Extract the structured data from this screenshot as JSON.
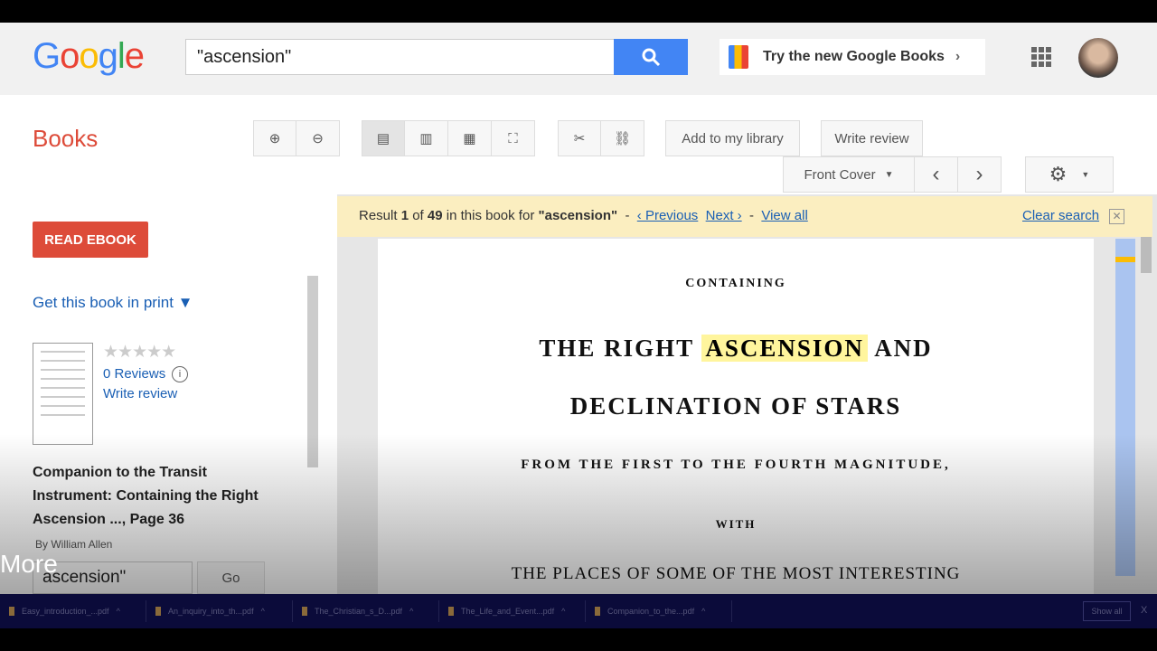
{
  "header": {
    "logo": "Google",
    "search_value": "\"ascension\"",
    "try_new": "Try the new Google Books"
  },
  "toolbar": {
    "brand": "Books",
    "add_library": "Add to my library",
    "write_review": "Write review",
    "front_cover": "Front Cover"
  },
  "sidebar": {
    "read_ebook": "READ EBOOK",
    "get_print": "Get this book in print ▼",
    "reviews": "0 Reviews",
    "write_review": "Write review",
    "rating": 0,
    "book_title": "Companion to the Transit Instrument: Containing the Right Ascension ..., Page 36",
    "author": "By William Allen",
    "search_value": "ascension\"",
    "go": "Go",
    "overlay": "More"
  },
  "search_result": {
    "prefix": "Result",
    "current": "1",
    "of": "of",
    "total": "49",
    "mid": "in this book for",
    "query": "\"ascension\"",
    "dash": "-",
    "previous": "‹ Previous",
    "next": "Next ›",
    "view_all": "View all",
    "clear": "Clear search"
  },
  "page": {
    "l1": "CONTAINING",
    "l2a": "THE RIGHT",
    "l2b": "ASCENSION",
    "l2c": "AND",
    "l3": "DECLINATION OF STARS",
    "l4": "FROM THE FIRST TO THE FOURTH MAGNITUDE,",
    "l5": "WITH",
    "l6": "THE PLACES OF SOME OF THE MOST INTERESTING"
  },
  "downloads": {
    "items": [
      "Easy_introduction_...pdf",
      "An_inquiry_into_th...pdf",
      "The_Christian_s_D...pdf",
      "The_Life_and_Event...pdf",
      "Companion_to_the...pdf"
    ],
    "show_all": "Show all",
    "close": "X"
  },
  "colors": {
    "accent": "#dd4b39",
    "blue": "#4285f4",
    "highlight": "#fff59d",
    "result_bar": "#fbeec0"
  }
}
